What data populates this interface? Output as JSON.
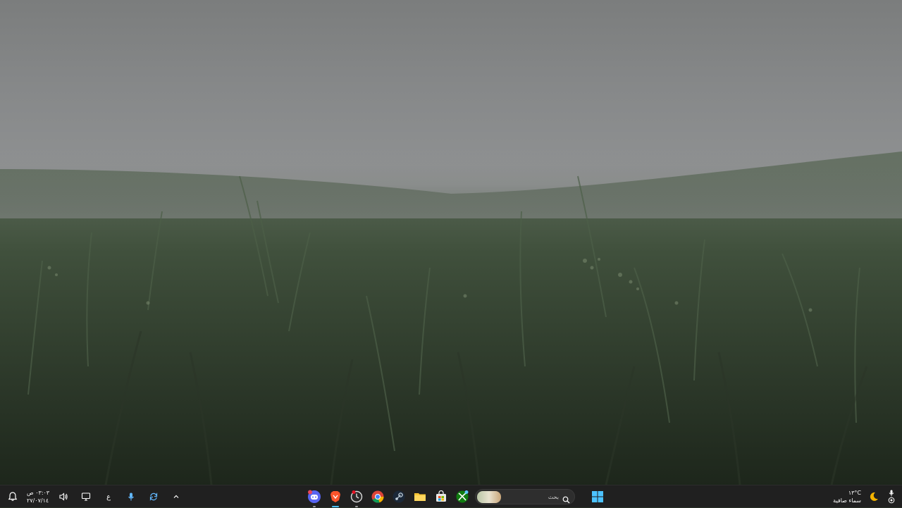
{
  "desktop": {
    "wallpaper": "misty grass field"
  },
  "taskbar": {
    "clock": {
      "time": "٠٣:٠٣ ص",
      "date": "٢٧/٠٧/١٤"
    },
    "language": "ع",
    "search": {
      "placeholder": "بحث"
    },
    "weather": {
      "temperature": "١٣°C",
      "condition": "سماء صافية"
    },
    "pinned_apps": [
      {
        "name": "Discord",
        "icon": "discord-icon"
      },
      {
        "name": "Brave",
        "icon": "brave-icon",
        "active": true
      },
      {
        "name": "Clock",
        "icon": "clock-app-icon"
      },
      {
        "name": "Chrome",
        "icon": "chrome-icon"
      },
      {
        "name": "Steam",
        "icon": "steam-icon"
      },
      {
        "name": "File Explorer",
        "icon": "folder-icon"
      },
      {
        "name": "Microsoft Store",
        "icon": "store-icon"
      },
      {
        "name": "Xbox",
        "icon": "xbox-icon"
      }
    ],
    "colors": {
      "taskbar_bg": "#202020",
      "accent": "#4cc2ff"
    }
  }
}
